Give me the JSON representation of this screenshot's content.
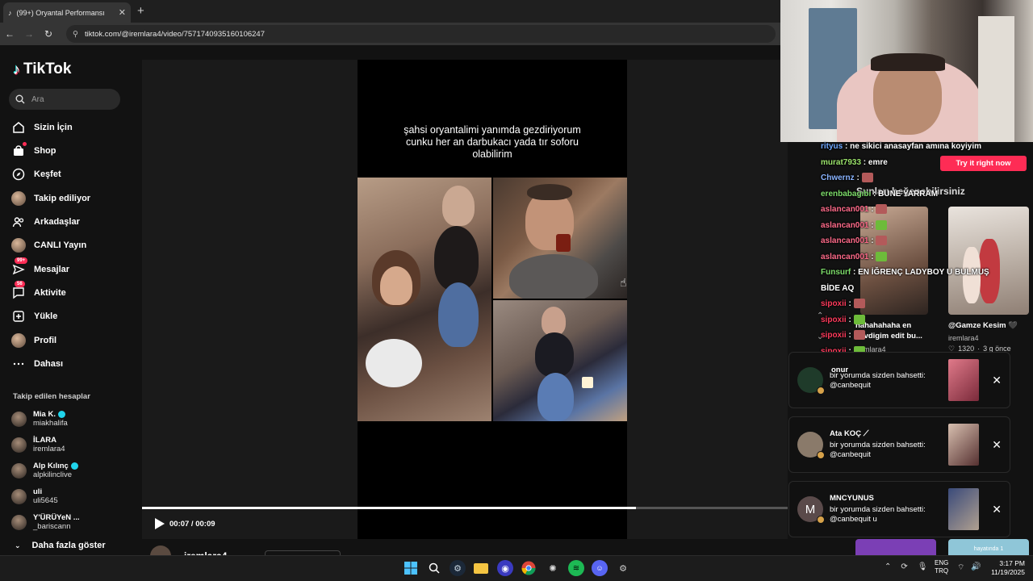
{
  "browser": {
    "tab_title": "(99+) Oryantal Performansı",
    "tab_close": "✕",
    "new_tab": "+",
    "url": "tiktok.com/@iremlara4/video/7571740935160106247"
  },
  "sidebar": {
    "logo": "TikTok",
    "search_placeholder": "Ara",
    "items": [
      {
        "label": "Sizin İçin",
        "icon": "home-icon"
      },
      {
        "label": "Shop",
        "icon": "shop-icon"
      },
      {
        "label": "Keşfet",
        "icon": "compass-icon"
      },
      {
        "label": "Takip ediliyor",
        "icon": "following-avatar"
      },
      {
        "label": "Arkadaşlar",
        "icon": "friends-icon"
      },
      {
        "label": "CANLI Yayın",
        "icon": "live-avatar"
      },
      {
        "label": "Mesajlar",
        "icon": "messages-icon",
        "badge": "99+"
      },
      {
        "label": "Aktivite",
        "icon": "activity-icon",
        "badge": "56"
      },
      {
        "label": "Yükle",
        "icon": "upload-icon"
      },
      {
        "label": "Profil",
        "icon": "profile-avatar"
      },
      {
        "label": "Dahası",
        "icon": "more-icon"
      }
    ],
    "following_header": "Takip edilen hesaplar",
    "accounts": [
      {
        "name": "Mia K.",
        "handle": "miakhalifa",
        "verified": true
      },
      {
        "name": "İLARA",
        "handle": "iremlara4",
        "verified": false
      },
      {
        "name": "Alp Kılınç",
        "handle": "alpkilinclive",
        "verified": true
      },
      {
        "name": "uli",
        "handle": "uli5645",
        "verified": false
      },
      {
        "name": "Y'ÜRÜYeN ...",
        "handle": "_bariscann",
        "verified": false
      }
    ],
    "show_more": "Daha fazla göster"
  },
  "video": {
    "caption": "şahsi oryantalimi yanımda gezdiriyorum cunku her an darbukacı yada tır soforu olabilirim",
    "time": "00:07 / 00:09",
    "progress": 0.765,
    "bottom_username": "iremlara4"
  },
  "chat": [
    {
      "user": "rityus",
      "color": "#6fa8ff",
      "text": "ne sikici anasayfan amına koyiyim"
    },
    {
      "user": "murat7933",
      "color": "#9be36b",
      "text": "emre"
    },
    {
      "user": "Chwernz",
      "color": "#8ab4ff",
      "text": "",
      "emote": true
    },
    {
      "user": "erenbabagıbı",
      "color": "#7ddc6a",
      "text": "BUNE YARRAM"
    },
    {
      "user": "aslancan001",
      "color": "#ff6b8a",
      "text": "",
      "emote": true
    },
    {
      "user": "aslancan001",
      "color": "#ff6b8a",
      "text": "",
      "emote": true
    },
    {
      "user": "aslancan001",
      "color": "#ff6b8a",
      "text": "",
      "emote": true
    },
    {
      "user": "aslancan001",
      "color": "#ff6b8a",
      "text": "",
      "emote": true
    },
    {
      "user": "Funsurf",
      "color": "#7ddc6a",
      "text": "EN İĞRENÇ LADYBOY U BULMUŞ"
    },
    {
      "user": "",
      "color": "#ffffff",
      "text": "BİDE AQ"
    },
    {
      "user": "sipoxii",
      "color": "#ff3b5c",
      "text": "",
      "emote": true
    },
    {
      "user": "sipoxii",
      "color": "#ff3b5c",
      "text": "",
      "emote": true
    },
    {
      "user": "sipoxii",
      "color": "#ff3b5c",
      "text": "",
      "emote": true
    },
    {
      "user": "sipoxii",
      "color": "#ff3b5c",
      "text": "",
      "emote": true
    },
    {
      "user": "sipoxii",
      "color": "#ff3b5c",
      "text": "",
      "emote": true
    },
    {
      "user": "murat7933",
      "color": "#9be36b",
      "text": "emre"
    }
  ],
  "suggested": {
    "header": "Şunları beğenebilirsiniz",
    "try_button": "Try it right now",
    "items": [
      {
        "title": "hahahahaha en sevdigim edit bu...",
        "user": "iremlara4"
      },
      {
        "title": "@Gamze Kesim 🖤",
        "user": "iremlara4",
        "likes": "1320",
        "age": "3 g önce"
      }
    ],
    "onur": "onur"
  },
  "notifications": [
    {
      "name": "",
      "text": "bir yorumda sizden bahsetti:",
      "mention": "@canbequit",
      "avatar": "",
      "avatar_color": "#1f3b2a"
    },
    {
      "name": "Ata KOÇ ⟋",
      "text": "bir yorumda sizden bahsetti:",
      "mention": "@canbequit",
      "avatar": "",
      "avatar_color": "#8a7a6a"
    },
    {
      "name": "MNCYUNUS",
      "text": "bir yorumda sizden bahsetti:",
      "mention": "@canbequit u",
      "avatar": "M",
      "avatar_color": "#5a4a4a"
    }
  ],
  "taskbar": {
    "lang_top": "ENG",
    "lang_bottom": "TRQ",
    "time": "3:17 PM",
    "date": "11/19/2025",
    "bottom_thumb_text": "hayatında 1"
  },
  "colors": {
    "accent": "#fe2c55",
    "verified": "#20d5ec"
  }
}
